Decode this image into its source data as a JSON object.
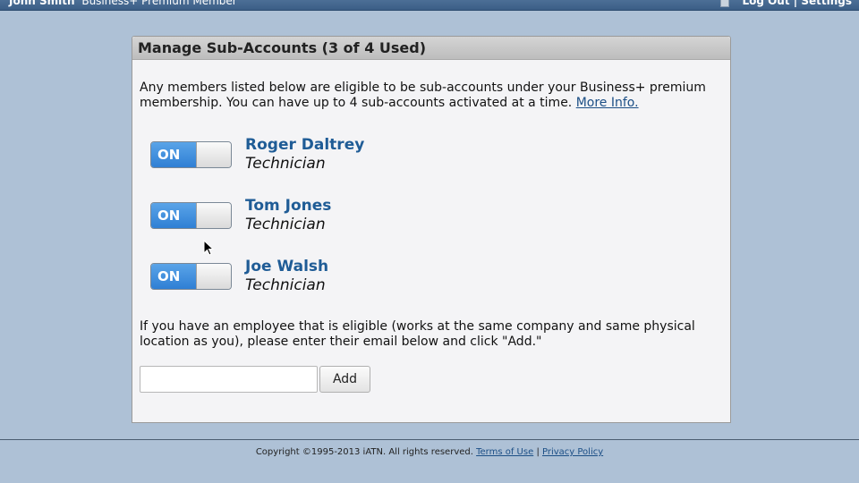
{
  "topbar": {
    "user_name": "John Smith",
    "membership": "Business+ Premium Member",
    "logout_label": "Log Out",
    "separator": "|",
    "settings_label": "Settings"
  },
  "panel": {
    "title": "Manage Sub-Accounts (3 of 4 Used)",
    "intro_text": "Any members listed below are eligible to be sub-accounts under your Business+ premium membership. You can have up to 4 sub-accounts activated at a time.",
    "more_info_label": "More Info.",
    "members": [
      {
        "name": "Roger Daltrey",
        "role": "Technician",
        "toggle_label": "ON"
      },
      {
        "name": "Tom Jones",
        "role": "Technician",
        "toggle_label": "ON"
      },
      {
        "name": "Joe Walsh",
        "role": "Technician",
        "toggle_label": "ON"
      }
    ],
    "eligible_text": "If you have an employee that is eligible (works at the same company and same physical location as you), please enter their email below and click \"Add.\"",
    "email_value": "",
    "add_label": "Add"
  },
  "footer": {
    "copyright": "Copyright ©1995-2013 iATN. All rights reserved.",
    "terms_label": "Terms of Use",
    "separator": "|",
    "privacy_label": "Privacy Policy"
  },
  "colors": {
    "background": "#aec1d6",
    "toggle_on": "#2f7fd4",
    "member_name": "#1f5c96",
    "topbar": "#3b5e86"
  }
}
